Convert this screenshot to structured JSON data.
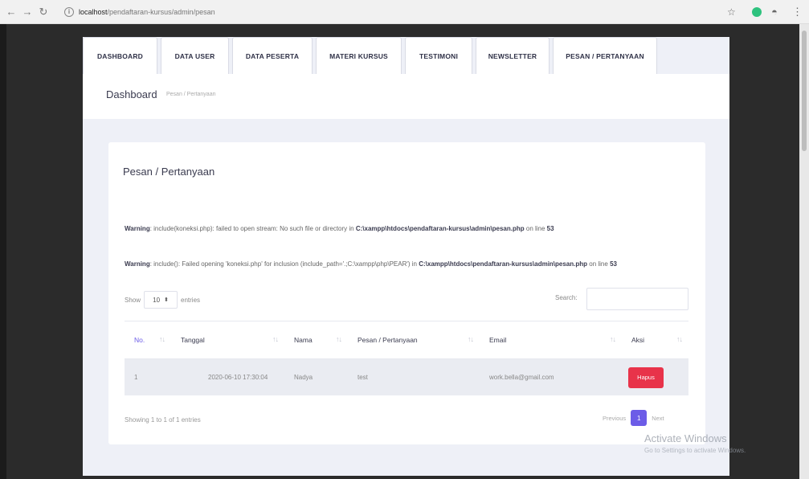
{
  "browser": {
    "url_host": "localhost",
    "url_path": "/pendaftaran-kursus/admin/pesan"
  },
  "tabs": [
    {
      "label": "DASHBOARD"
    },
    {
      "label": "DATA USER"
    },
    {
      "label": "DATA PESERTA"
    },
    {
      "label": "MATERI KURSUS"
    },
    {
      "label": "TESTIMONI"
    },
    {
      "label": "NEWSLETTER"
    },
    {
      "label": "PESAN / PERTANYAAN"
    }
  ],
  "header": {
    "title": "Dashboard",
    "breadcrumb": "Pesan / Pertanyaan"
  },
  "card": {
    "title": "Pesan / Pertanyaan"
  },
  "warnings": [
    {
      "label": "Warning",
      "text": ": include(koneksi.php): failed to open stream: No such file or directory in ",
      "file": "C:\\xampp\\htdocs\\pendaftaran-kursus\\admin\\pesan.php",
      "on": " on line ",
      "line": "53"
    },
    {
      "label": "Warning",
      "text": ": include(): Failed opening 'koneksi.php' for inclusion (include_path='.;C:\\xampp\\php\\PEAR') in ",
      "file": "C:\\xampp\\htdocs\\pendaftaran-kursus\\admin\\pesan.php",
      "on": " on line ",
      "line": "53"
    }
  ],
  "table_controls": {
    "show_label": "Show",
    "entries_value": "10",
    "entries_label": "entries",
    "search_label": "Search:"
  },
  "table": {
    "columns": [
      "No.",
      "Tanggal",
      "Nama",
      "Pesan / Pertanyaan",
      "Email",
      "Aksi"
    ],
    "rows": [
      {
        "no": "1",
        "tanggal": "2020-06-10 17:30:04",
        "nama": "Nadya",
        "pesan": "test",
        "email": "work.bella@gmail.com",
        "aksi": "Hapus"
      }
    ]
  },
  "footer": {
    "showing": "Showing 1 to 1 of 1 entries",
    "previous": "Previous",
    "current_page": "1",
    "next": "Next"
  },
  "os_watermark": {
    "line1": "Activate Windows",
    "line2": "Go to Settings to activate Windows."
  },
  "colors": {
    "accent": "#6c5ce7",
    "danger": "#e8334a"
  }
}
